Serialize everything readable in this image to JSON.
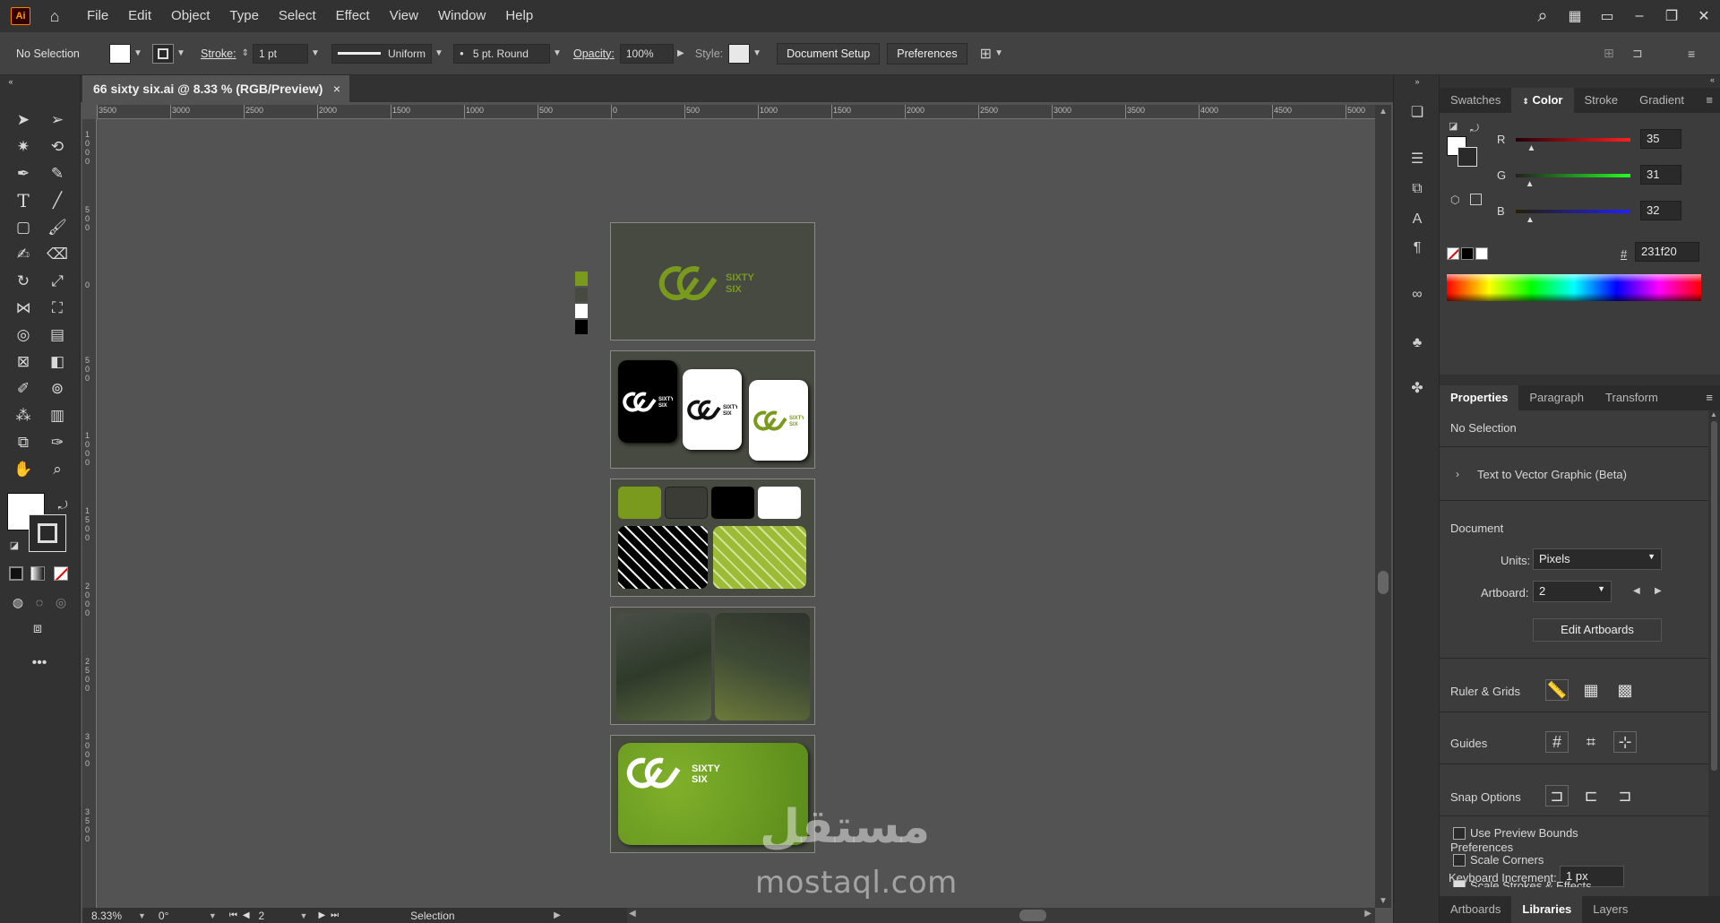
{
  "app": {
    "logo_text": "Ai",
    "menus": [
      "File",
      "Edit",
      "Object",
      "Type",
      "Select",
      "Effect",
      "View",
      "Window",
      "Help"
    ]
  },
  "control_bar": {
    "selection": "No Selection",
    "stroke_label": "Stroke:",
    "stroke_value": "1 pt",
    "profile": "Uniform",
    "brush": "5 pt. Round",
    "opacity_label": "Opacity:",
    "opacity_value": "100%",
    "style_label": "Style:",
    "document_setup": "Document Setup",
    "preferences": "Preferences"
  },
  "document": {
    "tab_title": "66 sixty six.ai @ 8.33 % (RGB/Preview)",
    "close": "×"
  },
  "ruler_top": [
    "3500",
    "3000",
    "2500",
    "2000",
    "1500",
    "1000",
    "500",
    "0",
    "500",
    "1000",
    "1500",
    "2000",
    "2500",
    "3000",
    "3500",
    "4000",
    "4500",
    "5000"
  ],
  "ruler_left": [
    "1000",
    "500",
    "0",
    "500",
    "1000",
    "1500",
    "2000",
    "2500",
    "3000",
    "3500"
  ],
  "artboards": {
    "brand_text_line1": "SIXTY",
    "brand_text_line2": "SIX",
    "palette": [
      "#7a9a1e",
      "#474a41",
      "#ffffff",
      "#000000"
    ]
  },
  "watermark": {
    "arabic": "مستقل",
    "latin": "mostaql.com"
  },
  "status": {
    "zoom": "8.33%",
    "rotation": "0°",
    "artboard": "2",
    "tool": "Selection"
  },
  "color_panel": {
    "tabs": [
      "Swatches",
      "Color",
      "Stroke",
      "Gradient"
    ],
    "active_tab": "Color",
    "r_label": "R",
    "r_value": "35",
    "g_label": "G",
    "g_value": "31",
    "b_label": "B",
    "b_value": "32",
    "hash": "#",
    "hex": "231f20",
    "r_fraction": 0.137,
    "g_fraction": 0.122,
    "b_fraction": 0.125
  },
  "properties": {
    "tabs": [
      "Properties",
      "Paragraph",
      "Transform"
    ],
    "active_tab": "Properties",
    "no_selection": "No Selection",
    "text_to_vector": "Text to Vector Graphic (Beta)",
    "document_label": "Document",
    "units_label": "Units:",
    "units_value": "Pixels",
    "artboard_label": "Artboard:",
    "artboard_value": "2",
    "edit_artboards": "Edit Artboards",
    "ruler_grids": "Ruler & Grids",
    "guides": "Guides",
    "snap_options": "Snap Options",
    "preferences": "Preferences",
    "keyboard_increment_label": "Keyboard Increment:",
    "keyboard_increment_value": "1 px",
    "use_preview_bounds": "Use Preview Bounds",
    "scale_corners": "Scale Corners",
    "scale_strokes": "Scale Strokes & Effects"
  },
  "bottom_tabs": [
    "Artboards",
    "Libraries",
    "Layers"
  ],
  "bottom_active": "Libraries",
  "colors": {
    "brand_green": "#7a9a1e",
    "artboard_bg": "#474a41"
  }
}
